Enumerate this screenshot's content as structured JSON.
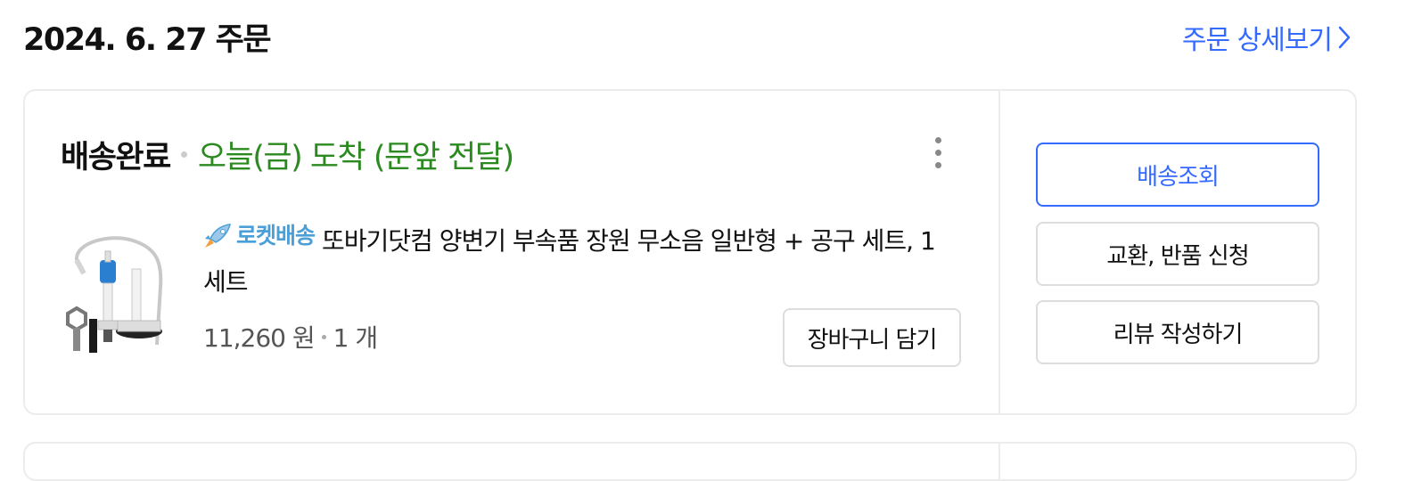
{
  "order": {
    "date_title": "2024. 6. 27 주문",
    "detail_link": "주문 상세보기"
  },
  "status": {
    "title": "배송완료",
    "arrival": "오늘(금) 도착 (문앞 전달)"
  },
  "product": {
    "badge": "로켓배송",
    "name": "또바기닷컴 양변기 부속품 장원 무소음 일반형 + 공구 세트, 1세트",
    "price": "11,260 원",
    "quantity": "1 개"
  },
  "buttons": {
    "add_to_cart": "장바구니 담기",
    "track_delivery": "배송조회",
    "exchange_return": "교환, 반품 신청",
    "write_review": "리뷰 작성하기"
  },
  "colors": {
    "accent": "#346aff",
    "arrival_green": "#2b8a1f",
    "rocket_blue": "#4a9fd8"
  },
  "icons": [
    "chevron-right-icon",
    "more-vertical-icon",
    "rocket-icon",
    "product-image"
  ]
}
